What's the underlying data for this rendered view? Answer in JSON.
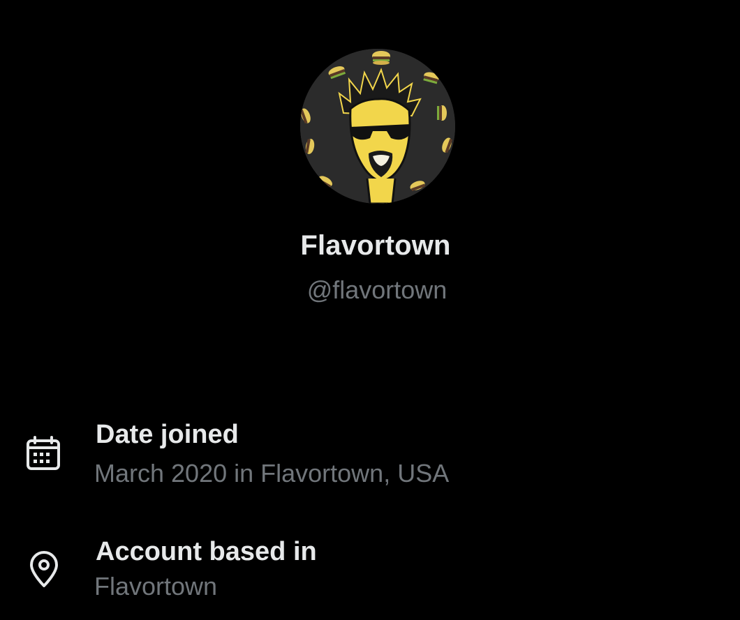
{
  "profile": {
    "display_name": "Flavortown",
    "handle": "@flavortown",
    "avatar_icon": "cartoon-face-avatar-icon"
  },
  "about": {
    "date_joined": {
      "icon": "calendar-icon",
      "title": "Date joined",
      "value": "March 2020 in Flavortown, USA"
    },
    "account_based": {
      "icon": "location-pin-icon",
      "title": "Account based in",
      "value": "Flavortown"
    }
  },
  "colors": {
    "background": "#000000",
    "primary_text": "#e7e9ea",
    "secondary_text": "#71767b",
    "avatar_accent": "#f2d64b"
  }
}
